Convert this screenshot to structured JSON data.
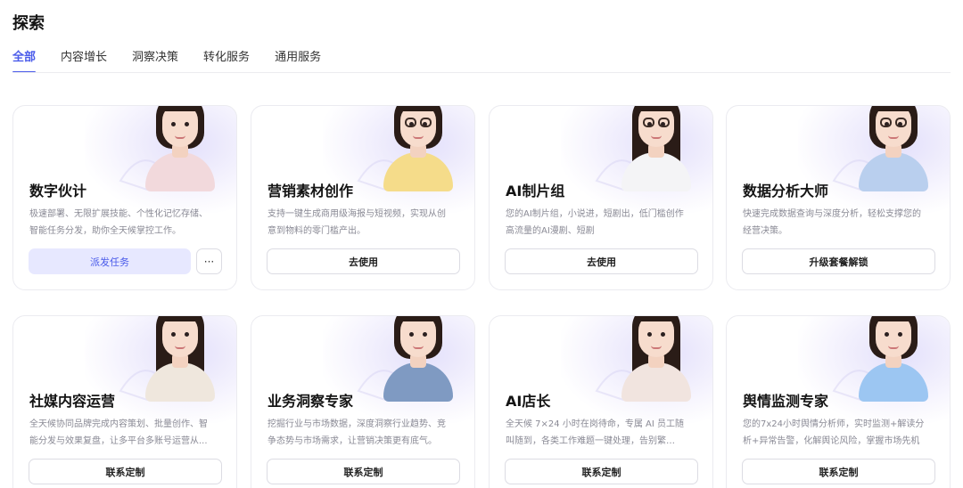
{
  "page": {
    "title": "探索"
  },
  "tabs": [
    {
      "label": "全部",
      "active": true
    },
    {
      "label": "内容增长",
      "active": false
    },
    {
      "label": "洞察决策",
      "active": false
    },
    {
      "label": "转化服务",
      "active": false
    },
    {
      "label": "通用服务",
      "active": false
    }
  ],
  "colors": {
    "accent": "#4a5bea",
    "primary_button_bg": "#e7e8ff"
  },
  "cards": [
    {
      "title": "数字伙计",
      "desc": "极速部署、无限扩展技能、个性化记忆存储、智能任务分发，助你全天候掌控工作。",
      "button": "派发任务",
      "primary": true,
      "more": "···",
      "avatar": {
        "hair": "short",
        "glasses": false,
        "top": "#f2d9dc"
      }
    },
    {
      "title": "营销素材创作",
      "desc": "支持一键生成商用级海报与短视频，实现从创意到物料的零门槛产出。",
      "button": "去使用",
      "avatar": {
        "hair": "short",
        "glasses": true,
        "top": "#f5dc8a"
      }
    },
    {
      "title": "AI制片组",
      "desc": "您的AI制片组，小说进，短剧出，低门槛创作高流量的AI漫剧、短剧",
      "button": "去使用",
      "avatar": {
        "hair": "long",
        "glasses": true,
        "top": "#f4f4f6"
      }
    },
    {
      "title": "数据分析大师",
      "desc": "快速完成数据查询与深度分析，轻松支撑您的经营决策。",
      "button": "升级套餐解锁",
      "avatar": {
        "hair": "short",
        "glasses": true,
        "top": "#b9cfee"
      }
    },
    {
      "title": "社媒内容运营",
      "desc": "全天候协同品牌完成内容策划、批量创作、智能分发与效果复盘，让多平台多账号运营从...",
      "button": "联系定制",
      "avatar": {
        "hair": "long",
        "glasses": false,
        "top": "#efe7dd"
      }
    },
    {
      "title": "业务洞察专家",
      "desc": "挖掘行业与市场数据，深度洞察行业趋势、竞争态势与市场需求，让营销决策更有底气。",
      "button": "联系定制",
      "avatar": {
        "hair": "short",
        "glasses": false,
        "top": "#7f9ac2"
      }
    },
    {
      "title": "AI店长",
      "desc": "全天候 7×24 小时在岗待命，专属 AI 员工随叫随到，各类工作难题一键处理，告别繁琐，...",
      "button": "联系定制",
      "avatar": {
        "hair": "long",
        "glasses": false,
        "top": "#f1e4df"
      }
    },
    {
      "title": "舆情监测专家",
      "desc": "您的7x24小时舆情分析师，实时监测+解读分析+异常告警，化解舆论风险，掌握市场先机",
      "button": "联系定制",
      "avatar": {
        "hair": "short",
        "glasses": false,
        "top": "#9cc6f2"
      }
    }
  ]
}
